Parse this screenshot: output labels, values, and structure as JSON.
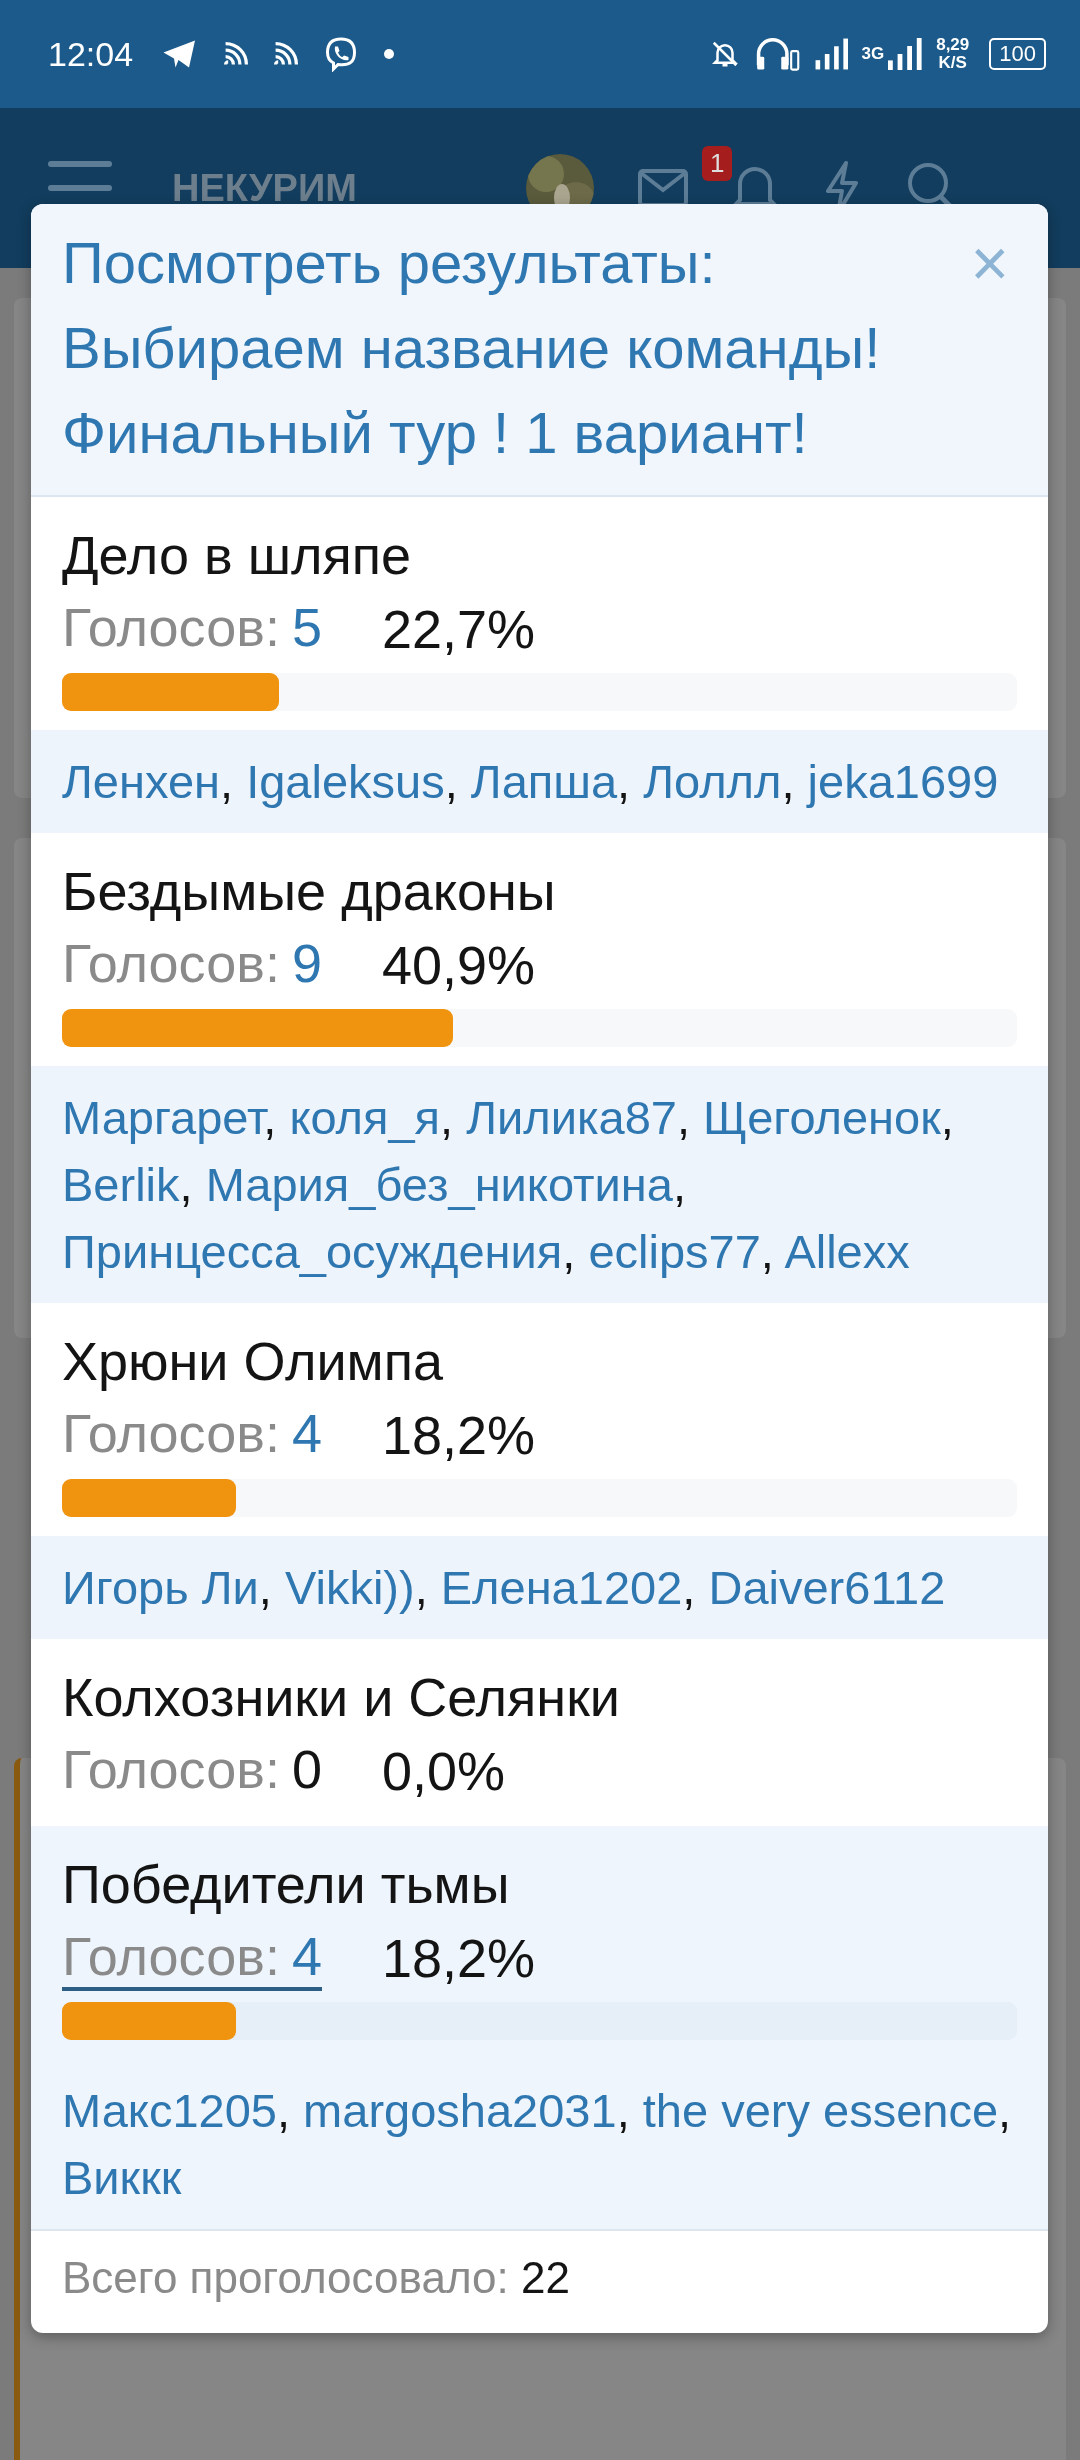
{
  "status_bar": {
    "time": "12:04",
    "network_type": "3G",
    "speed": "8,29",
    "speed_unit": "K/S",
    "battery": "100"
  },
  "header": {
    "logo": "НЕКУРИМ",
    "notification_count": "1"
  },
  "dialog": {
    "title": "Посмотреть результаты: Выбираем название команды! Финальный тур ! 1 вариант!",
    "close": "×",
    "options": [
      {
        "name": "Дело в шляпе",
        "votes_label": "Голосов:",
        "count": "5",
        "linked": true,
        "percent": "22,7%",
        "level": 0.227,
        "highlighted": false,
        "voters": [
          {
            "name": "Ленхен",
            "sep": ","
          },
          {
            "name": "Igaleksus",
            "sep": ","
          },
          {
            "name": "Лапша",
            "sep": ","
          },
          {
            "name": "Лоллл",
            "sep": ","
          },
          {
            "name": "jeka1699"
          }
        ]
      },
      {
        "name": "Бездымые драконы",
        "votes_label": "Голосов:",
        "count": "9",
        "linked": true,
        "percent": "40,9%",
        "level": 0.409,
        "highlighted": false,
        "voters": [
          {
            "name": "Маргарет",
            "sep": ","
          },
          {
            "name": "коля_я",
            "sep": ","
          },
          {
            "name": "Лилика87",
            "sep": ","
          },
          {
            "name": "Щеголенок",
            "sep": ","
          },
          {
            "name": "Berlik",
            "sep": ","
          },
          {
            "name": "Мария_без_никотина",
            "sep": ","
          },
          {
            "name": "Принцесса_осуждения",
            "sep": ","
          },
          {
            "name": "eclips77",
            "sep": ","
          },
          {
            "name": "Allexx"
          }
        ]
      },
      {
        "name": "Хрюни Олимпа",
        "votes_label": "Голосов:",
        "count": "4",
        "linked": true,
        "percent": "18,2%",
        "level": 0.182,
        "highlighted": false,
        "voters": [
          {
            "name": "Игорь Ли",
            "sep": ","
          },
          {
            "name": "Vikki))",
            "sep": ","
          },
          {
            "name": "Елена1202",
            "sep": ","
          },
          {
            "name": "Daiver6112"
          }
        ]
      },
      {
        "name": "Колхозники и Селянки",
        "votes_label": "Голосов:",
        "count": "0",
        "linked": false,
        "percent": "0,0%",
        "highlighted": false
      },
      {
        "name": "Победители тьмы",
        "votes_label": "Голосов:",
        "count": "4",
        "linked": true,
        "percent": "18,2%",
        "level": 0.182,
        "highlighted": true,
        "voters": [
          {
            "name": "Макс1205",
            "sep": ","
          },
          {
            "name": "margosha2031",
            "sep": ","
          },
          {
            "name": "the very essence",
            "sep": ","
          },
          {
            "name": "Виккк"
          }
        ]
      }
    ],
    "total_label": "Всего проголосовало:",
    "total": "22"
  }
}
